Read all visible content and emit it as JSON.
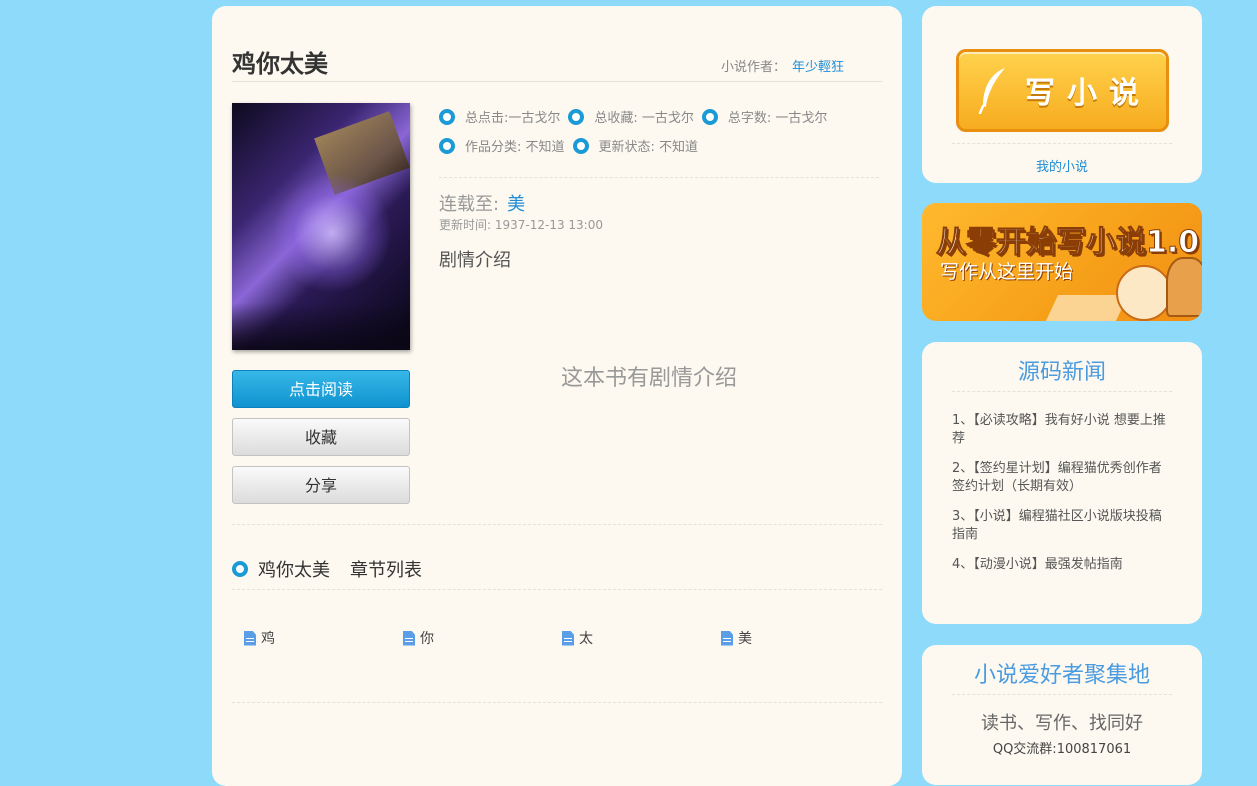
{
  "book": {
    "title": "鸡你太美",
    "author_label": "小说作者：",
    "author_name": "年少輕狂",
    "stats": [
      {
        "label": "总点击:一古戈尔"
      },
      {
        "label": "总收藏: 一古戈尔"
      },
      {
        "label": "总字数: 一古戈尔"
      },
      {
        "label": "作品分类: 不知道"
      },
      {
        "label": "更新状态: 不知道"
      }
    ],
    "serial_label": "连载至:",
    "serial_chapter": "美",
    "update_time": "更新时间: 1937-12-13 13:00",
    "intro_heading": "剧情介绍",
    "intro_text": "这本书有剧情介绍"
  },
  "buttons": {
    "read": "点击阅读",
    "favorite": "收藏",
    "share": "分享"
  },
  "chapters": {
    "book_name": "鸡你太美",
    "heading": "章节列表",
    "items": [
      "鸡",
      "你",
      "太",
      "美"
    ]
  },
  "sidebar": {
    "write_button": "写小说",
    "my_novels": "我的小说",
    "banner_title": "从零开始写小说1.0",
    "banner_subtitle": "写作从这里开始",
    "news_title": "源码新闻",
    "news": [
      "1、【必读攻略】我有好小说 想要上推荐",
      "2、【签约星计划】编程猫优秀创作者签约计划（长期有效）",
      "3、【小说】编程猫社区小说版块投稿指南",
      "4、【动漫小说】最强发帖指南"
    ],
    "community_title": "小说爱好者聚集地",
    "community_slogan": "读书、写作、找同好",
    "community_qq": "QQ交流群:100817061"
  },
  "colors": {
    "page_bg": "#8ddafb",
    "panel_bg": "#fdf9f0",
    "accent": "#1a9ad6",
    "link": "#1f8dd6"
  }
}
